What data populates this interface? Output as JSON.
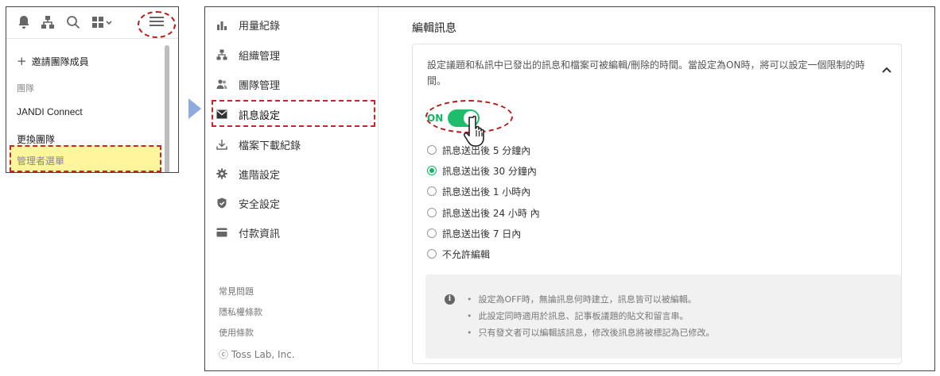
{
  "mini_panel": {
    "invite_label": "邀請團隊成員",
    "team_section": "團隊",
    "jandi_connect": "JANDI Connect",
    "switch_team": "更換團隊",
    "admin_menu": "管理者選單"
  },
  "sidebar": {
    "items": [
      {
        "label": "用量紀錄",
        "icon": "bar-chart-icon"
      },
      {
        "label": "組織管理",
        "icon": "org-chart-icon"
      },
      {
        "label": "團隊管理",
        "icon": "people-icon"
      },
      {
        "label": "訊息設定",
        "icon": "envelope-icon"
      },
      {
        "label": "檔案下載紀錄",
        "icon": "download-icon"
      },
      {
        "label": "進階設定",
        "icon": "gear-icon"
      },
      {
        "label": "安全設定",
        "icon": "shield-icon"
      },
      {
        "label": "付款資訊",
        "icon": "card-icon"
      }
    ],
    "footer": {
      "faq": "常見問題",
      "privacy": "隱私權條款",
      "terms": "使用條款",
      "copyright": "ⓒ Toss Lab, Inc."
    }
  },
  "content": {
    "title": "編輯訊息",
    "description": "設定議題和私訊中已發出的訊息和檔案可被編輯/刪除的時間。當設定為ON時，將可以設定一個限制的時間。",
    "toggle_label": "ON",
    "toggle_on": true,
    "options": [
      {
        "label": "訊息送出後 5 分鐘內",
        "checked": false
      },
      {
        "label": "訊息送出後 30 分鐘內",
        "checked": true
      },
      {
        "label": "訊息送出後 1 小時內",
        "checked": false
      },
      {
        "label": "訊息送出後 24 小時 內",
        "checked": false
      },
      {
        "label": "訊息送出後 7 日內",
        "checked": false
      },
      {
        "label": "不允許編輯",
        "checked": false
      }
    ],
    "notes": [
      "設定為OFF時，無論訊息何時建立，訊息皆可以被編輯。",
      "此設定同時適用於訊息、記事板議題的貼文和留言串。",
      "只有發文者可以編輯該訊息，修改後訊息將被標記為已修改。"
    ]
  },
  "colors": {
    "accent_green": "#1fbd6b",
    "highlight_yellow": "#fff59d",
    "annotation_red": "#c62828",
    "arrow_blue": "#8faadc"
  }
}
